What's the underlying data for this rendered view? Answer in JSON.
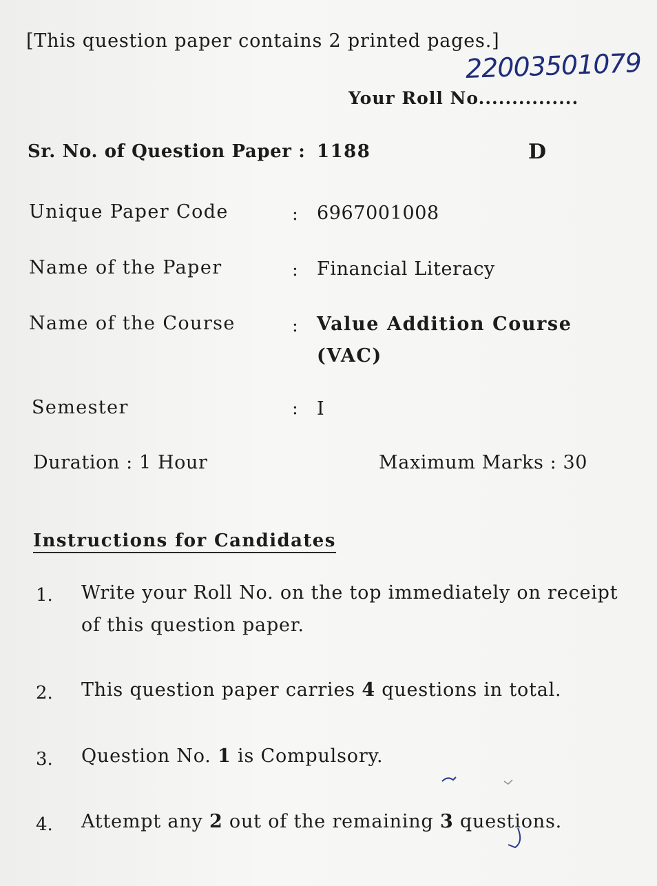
{
  "header": {
    "pages_note": "[This question paper contains 2 printed pages.]",
    "handwritten_roll": "22003501079",
    "roll_label": "Your Roll No",
    "roll_dots": "..............."
  },
  "paper": {
    "sr_no_label": "Sr. No. of Question Paper :",
    "sr_no_value": "1188",
    "set": "D"
  },
  "details": [
    {
      "label": "Unique Paper Code",
      "colon": ":",
      "value": "6967001008"
    },
    {
      "label": "Name of the Paper",
      "colon": ":",
      "value": "Financial Literacy"
    },
    {
      "label": "Name of the Course",
      "colon": ":",
      "value": "Value Addition Course",
      "value2": "(VAC)"
    },
    {
      "label": "Semester",
      "colon": ":",
      "value": "I"
    }
  ],
  "duration": "Duration : 1 Hour",
  "max_marks": "Maximum Marks : 30",
  "instructions": {
    "heading": "Instructions for Candidates",
    "items": [
      {
        "num": "1.",
        "line1": "Write your Roll No. on the top immediately on receipt",
        "line2": "of this question paper."
      },
      {
        "num": "2.",
        "pre": "This question paper carries ",
        "b1": "4",
        "post": " questions in total."
      },
      {
        "num": "3.",
        "pre": "Question No. ",
        "b1": "1",
        "post": " is Compulsory."
      },
      {
        "num": "4.",
        "pre": "Attempt any ",
        "b1": "2",
        "mid": " out of the remaining ",
        "b2": "3",
        "post": " questions."
      }
    ]
  }
}
